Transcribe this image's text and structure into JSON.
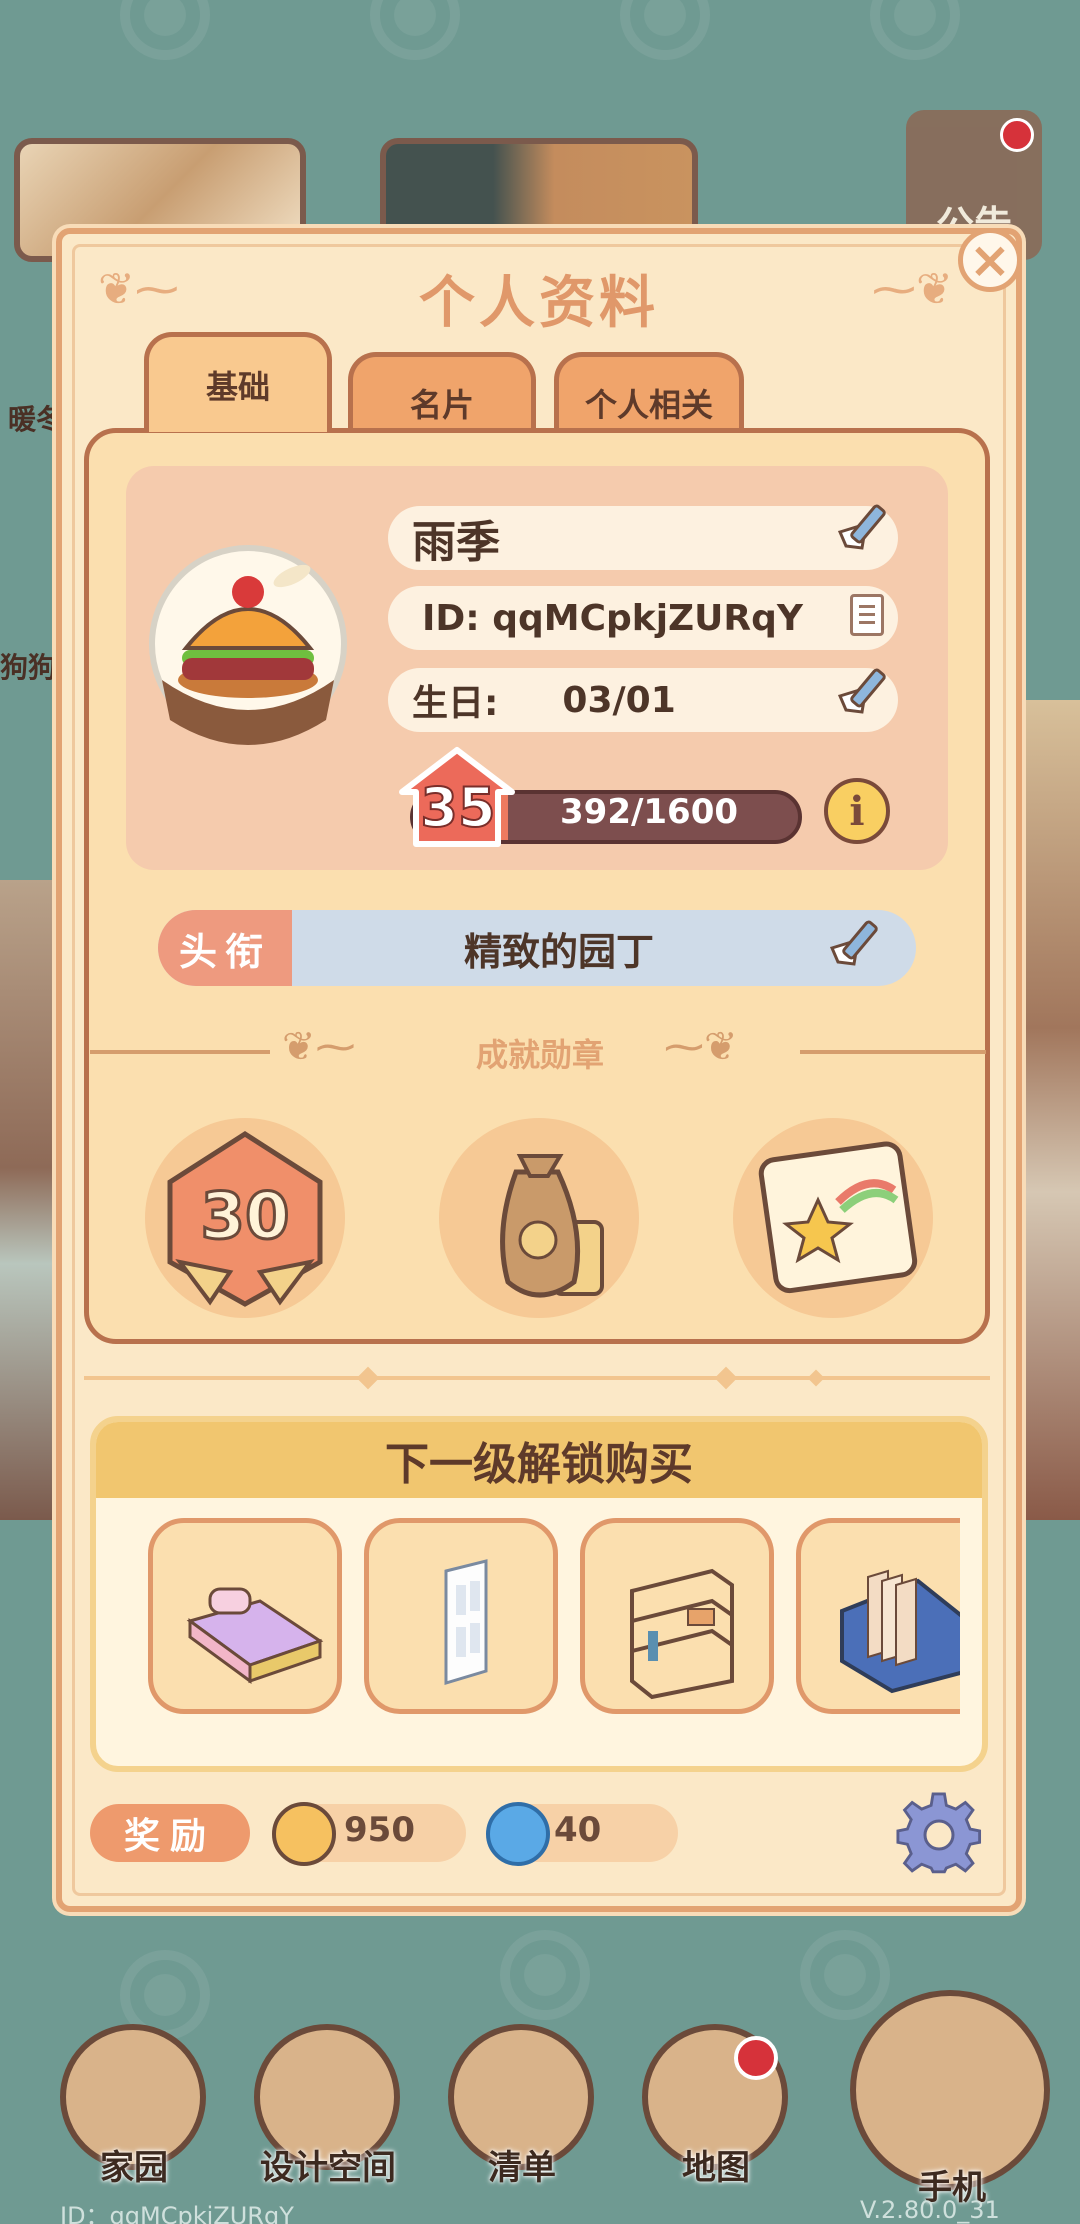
{
  "background": {
    "notice_label": "公告",
    "side_labels": [
      "暖冬",
      "狗狗"
    ]
  },
  "panel": {
    "title": "个人资料",
    "tabs": [
      {
        "label": "基础",
        "active": true
      },
      {
        "label": "名片",
        "active": false
      },
      {
        "label": "个人相关",
        "active": false
      }
    ]
  },
  "profile": {
    "name": "雨季",
    "id_text": "ID: qqMCpkjZURqY",
    "birthday_label": "生日:",
    "birthday_value": "03/01",
    "level": "35",
    "exp_text": "392/1600",
    "exp_progress": 0.245
  },
  "title": {
    "tag": "头衔",
    "value": "精致的园丁"
  },
  "achievements": {
    "label": "成就勋章",
    "medals": [
      {
        "name": "level-30-medal",
        "text": "30"
      },
      {
        "name": "money-bag-medal"
      },
      {
        "name": "shooting-star-map-medal"
      }
    ]
  },
  "unlock": {
    "heading": "下一级解锁购买",
    "items": [
      "bed-icon",
      "door-icon",
      "shelf-icon",
      "file-box-icon"
    ]
  },
  "rewards": {
    "tag": "奖励",
    "coins": "950",
    "gems": "40"
  },
  "nav": {
    "items": [
      {
        "label": "家园"
      },
      {
        "label": "设计空间"
      },
      {
        "label": "清单"
      },
      {
        "label": "地图"
      },
      {
        "label": "手机"
      }
    ]
  },
  "footer": {
    "id": "ID：qqMCpkjZURqY",
    "version": "V.2.80.0_31"
  },
  "colors": {
    "background": "#6f9a92",
    "panel": "#fbe8c7",
    "accent": "#e2a373",
    "title_tag": "#ee9a7f",
    "exp_fill": "#ee7a5f"
  }
}
